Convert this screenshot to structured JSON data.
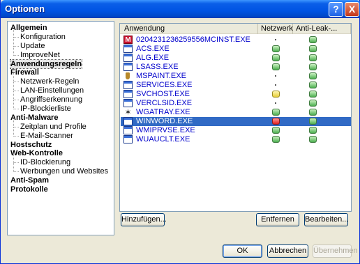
{
  "window": {
    "title": "Optionen"
  },
  "titlebar": {
    "help_label": "?",
    "close_label": "X"
  },
  "tree": [
    {
      "label": "Allgemein",
      "level": 0
    },
    {
      "label": "Konfiguration",
      "level": 1
    },
    {
      "label": "Update",
      "level": 1
    },
    {
      "label": "ImproveNet",
      "level": 1
    },
    {
      "label": "Anwendungsregeln",
      "level": 0,
      "selected": true
    },
    {
      "label": "Firewall",
      "level": 0
    },
    {
      "label": "Netzwerk-Regeln",
      "level": 1
    },
    {
      "label": "LAN-Einstellungen",
      "level": 1
    },
    {
      "label": "Angriffserkennung",
      "level": 1
    },
    {
      "label": "IP-Blockierliste",
      "level": 1
    },
    {
      "label": "Anti-Malware",
      "level": 0
    },
    {
      "label": "Zeitplan und Profile",
      "level": 1
    },
    {
      "label": "E-Mail-Scanner",
      "level": 1
    },
    {
      "label": "Hostschutz",
      "level": 0
    },
    {
      "label": "Web-Kontrolle",
      "level": 0
    },
    {
      "label": "ID-Blockierung",
      "level": 1
    },
    {
      "label": "Werbungen und Websites",
      "level": 1
    },
    {
      "label": "Anti-Spam",
      "level": 0
    },
    {
      "label": "Protokolle",
      "level": 0
    }
  ],
  "list": {
    "columns": [
      "Anwendung",
      "Netzwerk",
      "Anti-Leak-..."
    ],
    "rows": [
      {
        "name": "0204231236259556MCINST.EXE",
        "icon": "m-icon",
        "network": "none",
        "leak": "green"
      },
      {
        "name": "ACS.EXE",
        "icon": "window-icon",
        "network": "green",
        "leak": "green"
      },
      {
        "name": "ALG.EXE",
        "icon": "window-icon",
        "network": "green",
        "leak": "green"
      },
      {
        "name": "LSASS.EXE",
        "icon": "window-icon",
        "network": "green",
        "leak": "green"
      },
      {
        "name": "MSPAINT.EXE",
        "icon": "paint-icon",
        "network": "none",
        "leak": "green"
      },
      {
        "name": "SERVICES.EXE",
        "icon": "window-icon",
        "network": "none",
        "leak": "green"
      },
      {
        "name": "SVCHOST.EXE",
        "icon": "window-icon",
        "network": "yellow",
        "leak": "green"
      },
      {
        "name": "VERCLSID.EXE",
        "icon": "window-icon",
        "network": "none",
        "leak": "green"
      },
      {
        "name": "WGATRAY.EXE",
        "icon": "star-icon",
        "network": "green",
        "leak": "green"
      },
      {
        "name": "WINWORD.EXE",
        "icon": "window-icon",
        "network": "red",
        "leak": "green",
        "selected": true
      },
      {
        "name": "WMIPRVSE.EXE",
        "icon": "window-icon",
        "network": "green",
        "leak": "green"
      },
      {
        "name": "WUAUCLT.EXE",
        "icon": "window-icon",
        "network": "green",
        "leak": "green"
      }
    ]
  },
  "buttons": {
    "add": "Hinzufügen...",
    "remove": "Entfernen",
    "edit": "Bearbeiten...",
    "ok": "OK",
    "cancel": "Abbrechen",
    "apply": "Übernehmen"
  },
  "colors": {
    "accent": "#316ac5",
    "titlebar": "#0054e3",
    "link": "#0000cc"
  }
}
